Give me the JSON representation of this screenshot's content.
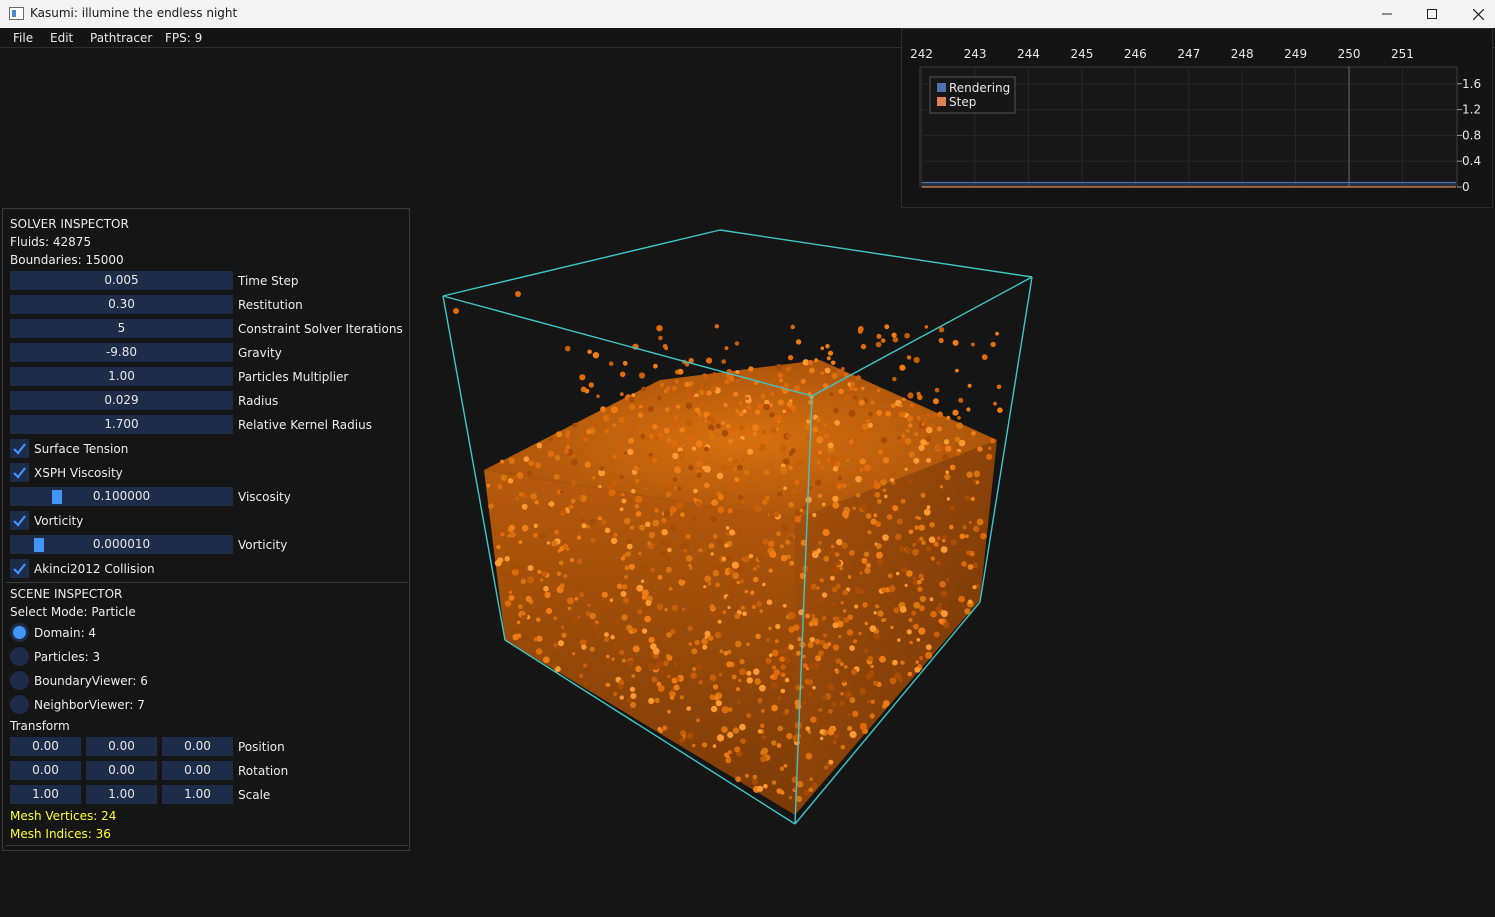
{
  "window": {
    "title": "Kasumi: illumine the endless night"
  },
  "menu": {
    "file": "File",
    "edit": "Edit",
    "pathtracer": "Pathtracer",
    "fps": "FPS: 9"
  },
  "solver": {
    "header": "SOLVER INSPECTOR",
    "fluids": "Fluids: 42875",
    "boundaries": "Boundaries: 15000",
    "params": [
      {
        "value": "0.005",
        "label": "Time Step"
      },
      {
        "value": "0.30",
        "label": "Restitution"
      },
      {
        "value": "5",
        "label": "Constraint Solver Iterations"
      },
      {
        "value": "-9.80",
        "label": "Gravity"
      },
      {
        "value": "1.00",
        "label": "Particles Multiplier"
      },
      {
        "value": "0.029",
        "label": "Radius"
      },
      {
        "value": "1.700",
        "label": "Relative Kernel Radius"
      }
    ],
    "surface_tension": {
      "label": "Surface Tension",
      "checked": true
    },
    "xsph": {
      "label": "XSPH Viscosity",
      "checked": true
    },
    "viscosity": {
      "value": "0.100000",
      "label": "Viscosity",
      "level": 0.1
    },
    "vorticity_toggle": {
      "label": "Vorticity",
      "checked": true
    },
    "vorticity": {
      "value": "0.000010",
      "label": "Vorticity",
      "level": 0.0
    },
    "akinci": {
      "label": "Akinci2012 Collision",
      "checked": true
    }
  },
  "scene": {
    "header": "SCENE INSPECTOR",
    "select_mode": "Select Mode: Particle",
    "objects": [
      {
        "label": "Domain: 4",
        "selected": true
      },
      {
        "label": "Particles: 3",
        "selected": false
      },
      {
        "label": "BoundaryViewer: 6",
        "selected": false
      },
      {
        "label": "NeighborViewer: 7",
        "selected": false
      }
    ],
    "transform_header": "Transform",
    "position": {
      "label": "Position",
      "values": [
        "0.00",
        "0.00",
        "0.00"
      ]
    },
    "rotation": {
      "label": "Rotation",
      "values": [
        "0.00",
        "0.00",
        "0.00"
      ]
    },
    "scale": {
      "label": "Scale",
      "values": [
        "1.00",
        "1.00",
        "1.00"
      ]
    },
    "mesh_vertices": "Mesh Vertices: 24",
    "mesh_indices": "Mesh Indices: 36"
  },
  "colors": {
    "accent": "#4296fa",
    "field_bg": "#1d2c48",
    "box_edge": "#3fc7c7",
    "particle": "#e0700f",
    "warning_text": "#ffff33"
  },
  "chart_data": {
    "type": "area",
    "x_ticks": [
      "242",
      "243",
      "244",
      "245",
      "246",
      "247",
      "248",
      "249",
      "250",
      "251"
    ],
    "y_ticks": [
      "1.6",
      "1.2",
      "0.8",
      "0.4",
      "0"
    ],
    "xlim": [
      241.97,
      252.02
    ],
    "ylim": [
      0,
      1.86
    ],
    "legend": "top-left",
    "series": [
      {
        "name": "Rendering",
        "color": "#4c72b0",
        "x": [
          242,
          246,
          250,
          252
        ],
        "values": [
          0.07,
          0.07,
          0.07,
          0.07
        ]
      },
      {
        "name": "Step",
        "color": "#dd8452",
        "x": [
          242,
          246,
          250,
          252
        ],
        "values": [
          0.0,
          0.0,
          0.0,
          0.0
        ]
      }
    ],
    "cursor_x": 250
  }
}
